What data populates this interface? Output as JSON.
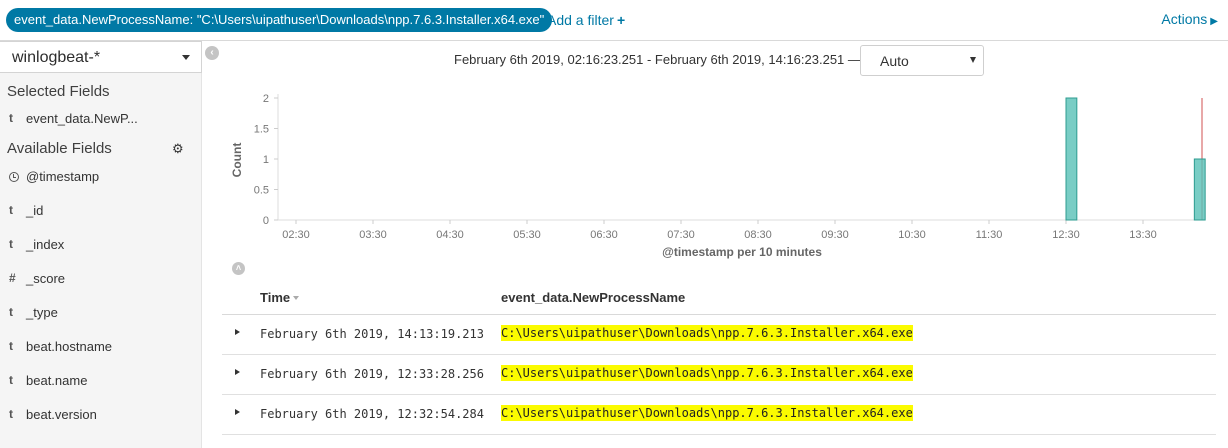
{
  "filterbar": {
    "filter_pill": "event_data.NewProcessName: \"C:\\Users\\uipathuser\\Downloads\\npp.7.6.3.Installer.x64.exe\"",
    "add_filter": "Add a filter",
    "add_filter_icon": "plus-icon",
    "actions": "Actions",
    "actions_icon": "caret-right-icon"
  },
  "sidebar": {
    "index_pattern": "winlogbeat-*",
    "selected_title": "Selected Fields",
    "selected_fields": [
      {
        "type": "t",
        "name": "event_data.NewP..."
      }
    ],
    "available_title": "Available Fields",
    "available_fields": [
      {
        "type": "clock",
        "name": "@timestamp"
      },
      {
        "type": "t",
        "name": "_id"
      },
      {
        "type": "t",
        "name": "_index"
      },
      {
        "type": "#",
        "name": "_score"
      },
      {
        "type": "t",
        "name": "_type"
      },
      {
        "type": "t",
        "name": "beat.hostname"
      },
      {
        "type": "t",
        "name": "beat.name"
      },
      {
        "type": "t",
        "name": "beat.version"
      }
    ]
  },
  "histogram": {
    "range_text": "February 6th 2019, 02:16:23.251 - February 6th 2019, 14:16:23.251 —",
    "interval": "Auto",
    "bar_color": "#57c1b7",
    "marker_color": "#e08a8a"
  },
  "chart_data": {
    "type": "bar",
    "ylabel": "Count",
    "xlabel": "@timestamp per 10 minutes",
    "ylim": [
      0,
      2
    ],
    "yticks": [
      "0",
      "0.5",
      "1",
      "1.5",
      "2"
    ],
    "xticks": [
      "02:30",
      "03:30",
      "04:30",
      "05:30",
      "06:30",
      "07:30",
      "08:30",
      "09:30",
      "10:30",
      "11:30",
      "12:30",
      "13:30"
    ],
    "bars": [
      {
        "x": "12:30",
        "value": 2
      },
      {
        "x": "14:10",
        "value": 1
      }
    ]
  },
  "table": {
    "col_time": "Time",
    "col_field": "event_data.NewProcessName",
    "rows": [
      {
        "time": "February 6th 2019, 14:13:19.213",
        "value": "C:\\Users\\uipathuser\\Downloads\\npp.7.6.3.Installer.x64.exe"
      },
      {
        "time": "February 6th 2019, 12:33:28.256",
        "value": "C:\\Users\\uipathuser\\Downloads\\npp.7.6.3.Installer.x64.exe"
      },
      {
        "time": "February 6th 2019, 12:32:54.284",
        "value": "C:\\Users\\uipathuser\\Downloads\\npp.7.6.3.Installer.x64.exe"
      }
    ]
  }
}
